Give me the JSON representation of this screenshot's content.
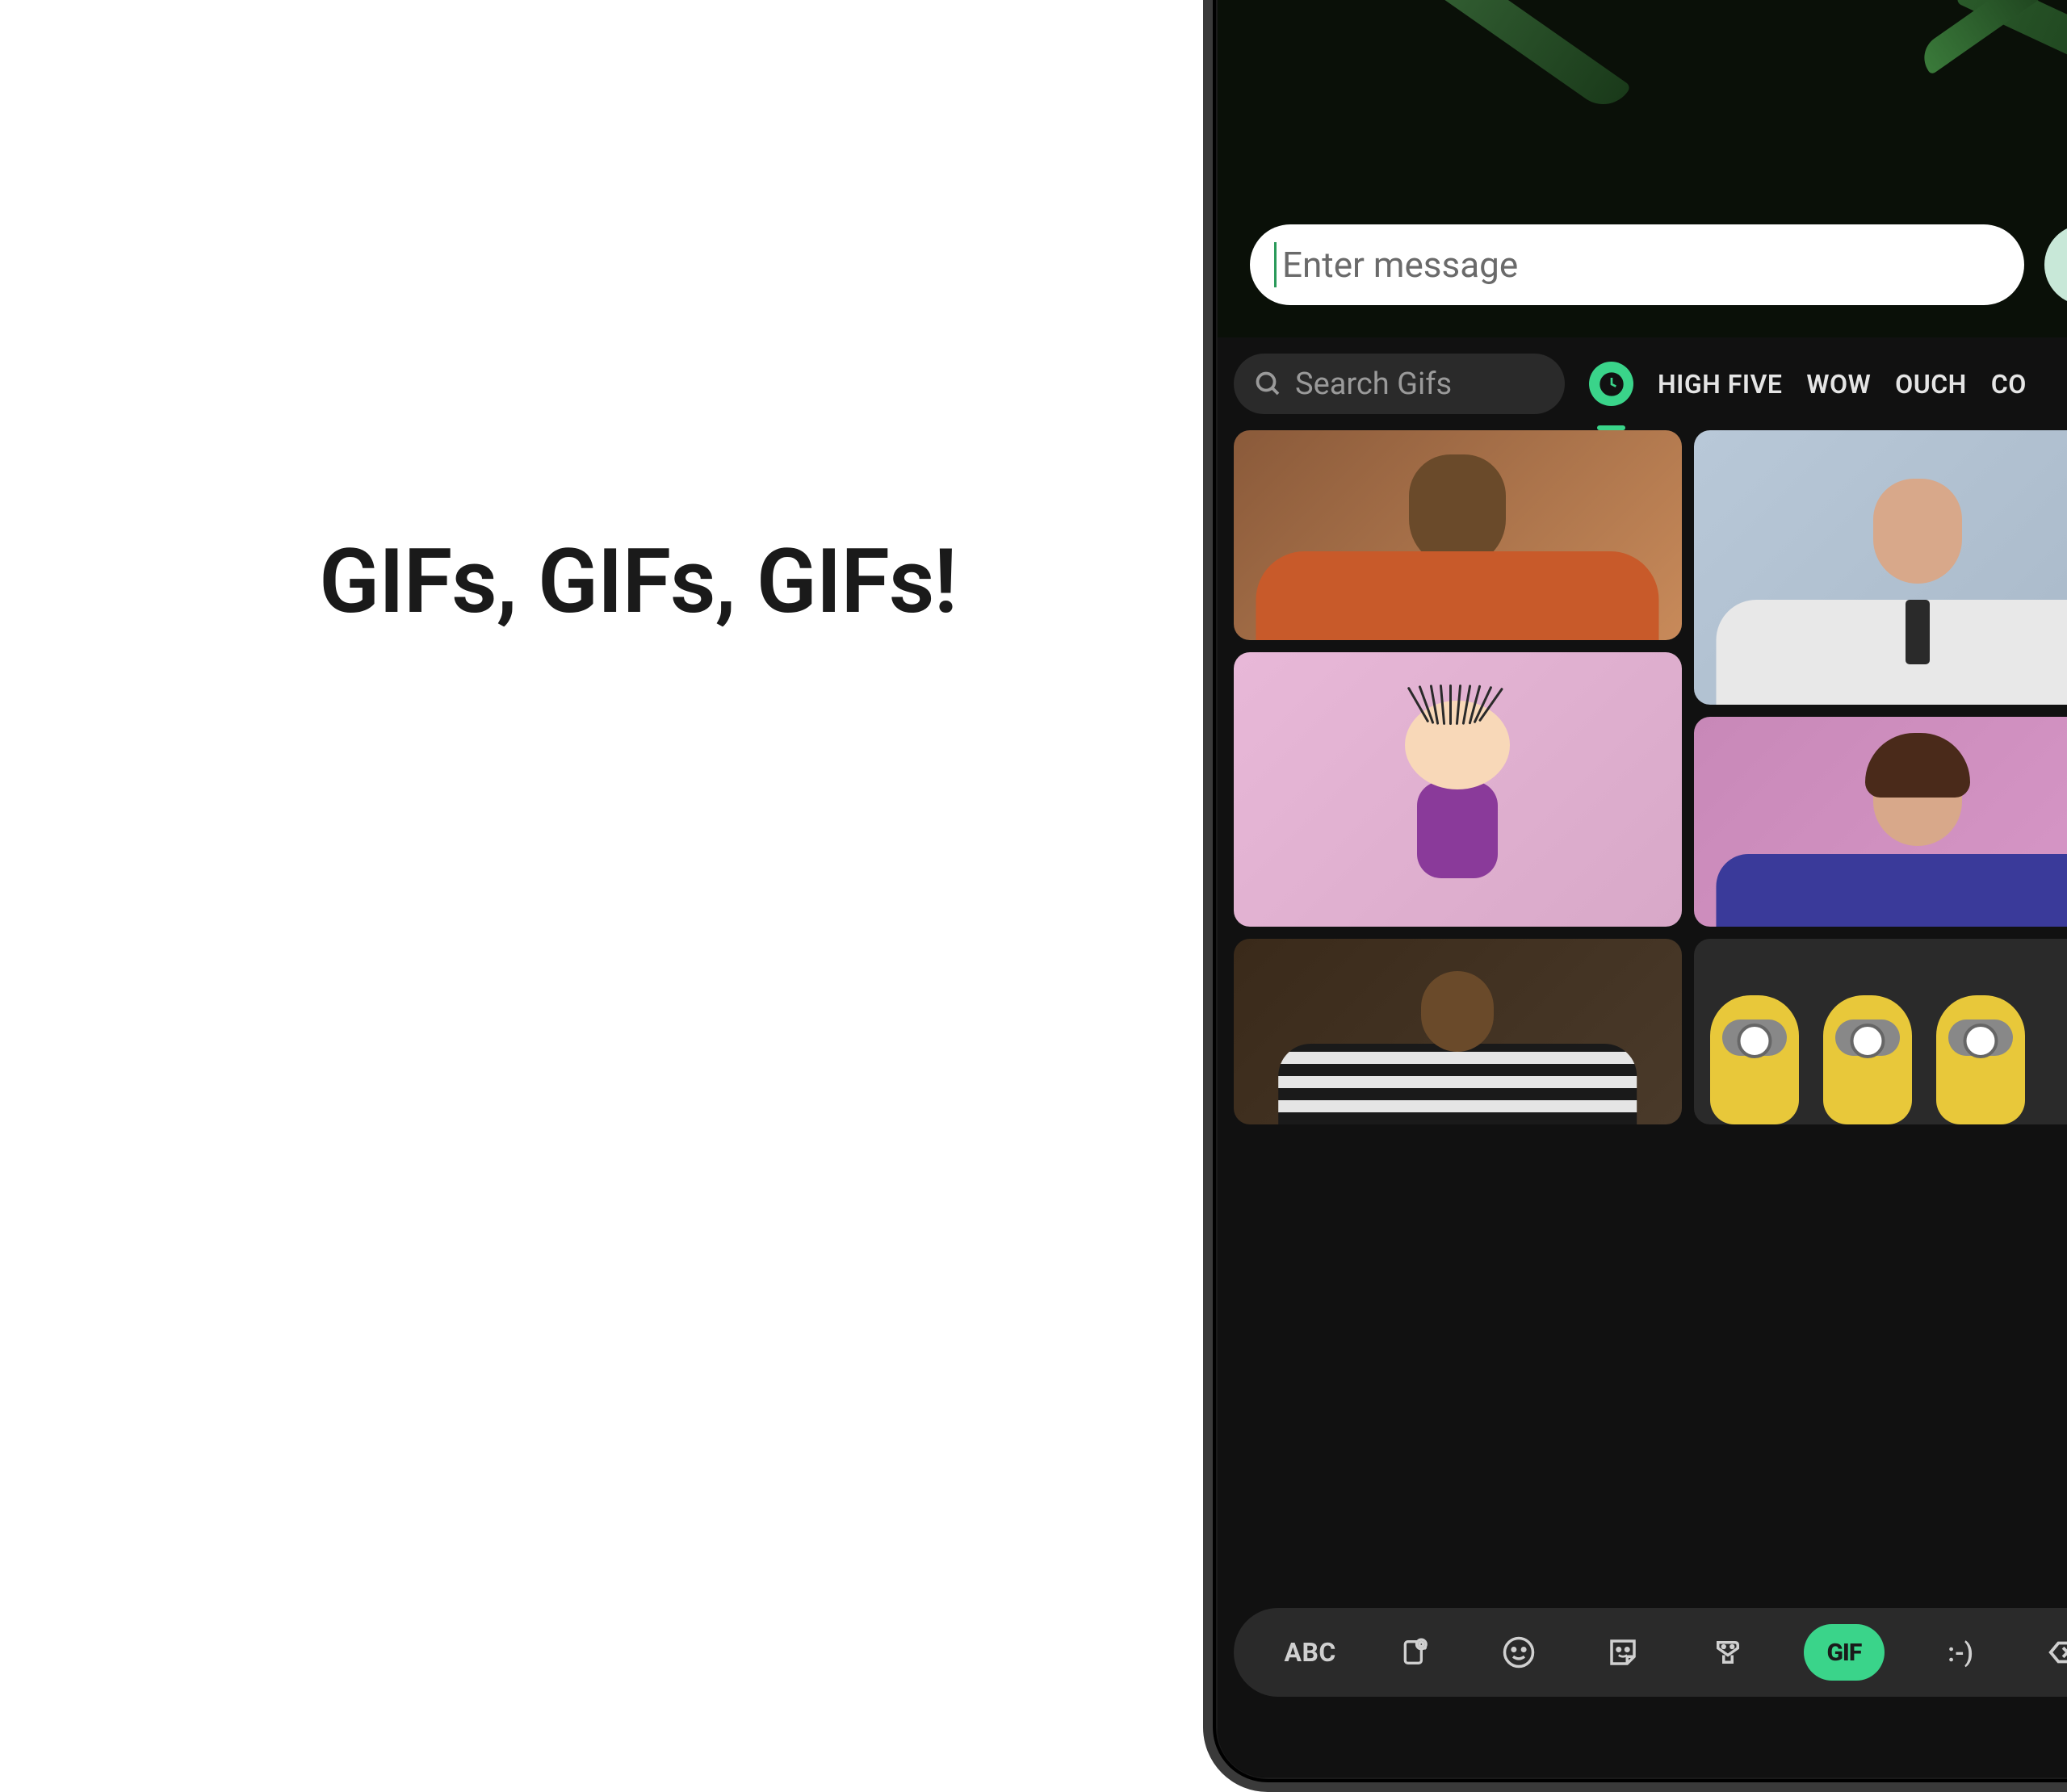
{
  "headline": "GIFs, GIFs, GIFs!",
  "message_input": {
    "placeholder": "Enter message"
  },
  "gif_search": {
    "placeholder": "Search Gifs"
  },
  "categories": {
    "high_five": "HIGH FIVE",
    "wow": "WOW",
    "ouch": "OUCH",
    "cool": "CO"
  },
  "bottom_bar": {
    "abc": "ABC",
    "gif": "GIF",
    "emoticon": ":-)"
  }
}
